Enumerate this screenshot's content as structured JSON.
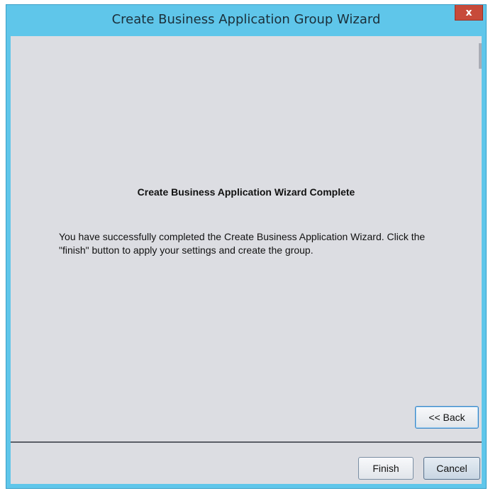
{
  "window": {
    "title": "Create Business Application Group Wizard",
    "close_glyph": "x"
  },
  "content": {
    "heading": "Create Business Application Wizard Complete",
    "description": "You have successfully completed the Create Business Application Wizard. Click the \"finish\" button to apply your settings and create the group."
  },
  "buttons": {
    "back": "<< Back",
    "finish": "Finish",
    "cancel": "Cancel"
  },
  "colors": {
    "titlebar": "#5fc6ea",
    "client_background": "#dcdde2",
    "close_button": "#c74a3a"
  }
}
